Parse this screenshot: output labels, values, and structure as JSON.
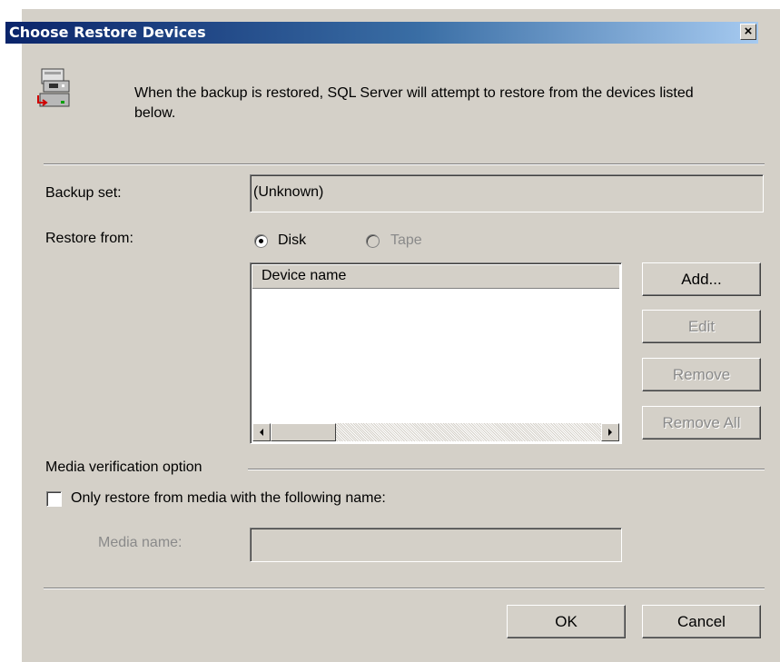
{
  "window": {
    "title": "Choose Restore Devices",
    "close_label": "×"
  },
  "header": {
    "message": "When the backup is restored, SQL Server will attempt to restore from the devices listed below.",
    "icon": "restore-device-icon"
  },
  "backup_set": {
    "label": "Backup set:",
    "value": "(Unknown)"
  },
  "restore_from": {
    "label": "Restore from:",
    "options": [
      {
        "label": "Disk",
        "checked": true,
        "enabled": true
      },
      {
        "label": "Tape",
        "checked": false,
        "enabled": false
      }
    ]
  },
  "device_list": {
    "column_header": "Device name",
    "rows": []
  },
  "device_buttons": {
    "add": "Add...",
    "edit": "Edit",
    "remove": "Remove",
    "remove_all": "Remove All"
  },
  "media_verification": {
    "group_label": "Media verification option",
    "checkbox_label": "Only restore from media with the following name:",
    "checked": false,
    "media_name_label": "Media name:",
    "media_name_value": ""
  },
  "footer": {
    "ok": "OK",
    "cancel": "Cancel"
  }
}
